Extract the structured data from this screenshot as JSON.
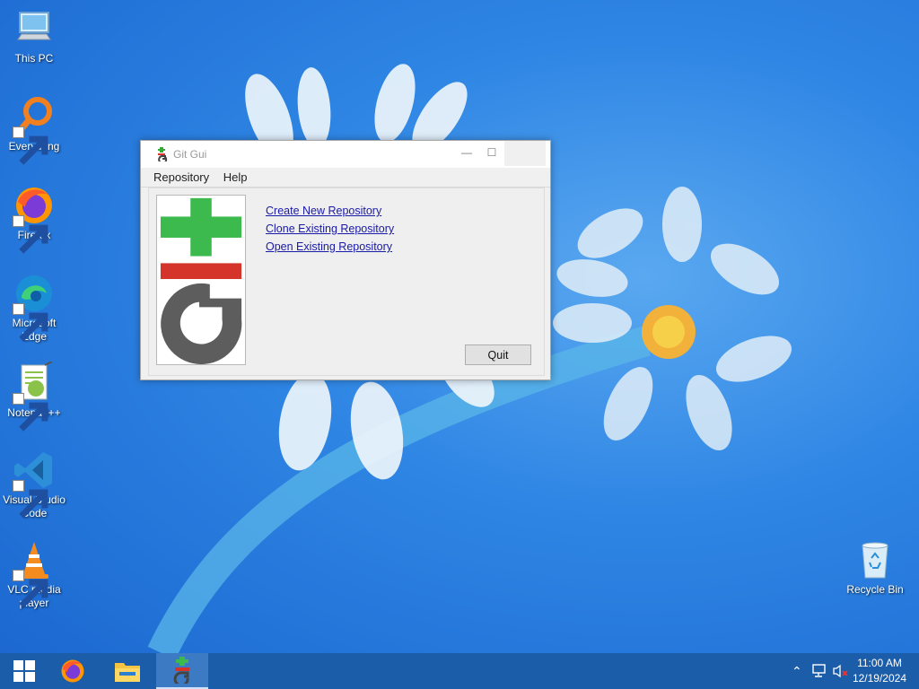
{
  "desktop": {
    "icons": [
      {
        "label": "This PC"
      },
      {
        "label": "Everything"
      },
      {
        "label": "Firefox"
      },
      {
        "label": "Microsoft Edge"
      },
      {
        "label": "Notepad++"
      },
      {
        "label": "Visual Studio Code"
      },
      {
        "label": "VLC media player"
      },
      {
        "label": "Recycle Bin"
      }
    ]
  },
  "window": {
    "title": "Git Gui",
    "menu": [
      "Repository",
      "Help"
    ],
    "links": [
      "Create New Repository",
      "Clone Existing Repository",
      "Open Existing Repository"
    ],
    "quit_label": "Quit",
    "link_color": "#1a1aa6"
  },
  "taskbar": {
    "items": [
      {
        "icon": "windows-start-icon"
      },
      {
        "icon": "firefox-icon"
      },
      {
        "icon": "file-explorer-icon"
      },
      {
        "icon": "git-gui-icon",
        "active": true
      }
    ],
    "tray": [
      "chevron-up-icon",
      "network-icon",
      "volume-muted-icon"
    ],
    "time": "11:00 AM",
    "date": "12/19/2024",
    "color": "#1b5da8"
  }
}
